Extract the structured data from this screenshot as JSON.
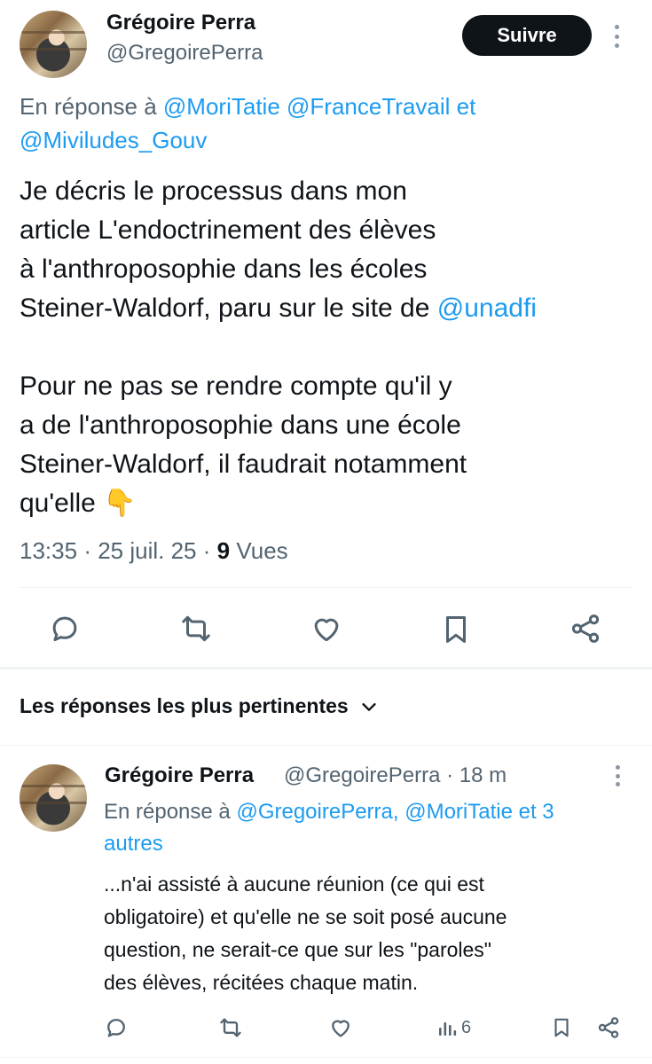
{
  "main_tweet": {
    "author_name": "Grégoire Perra",
    "handle": "@GregoirePerra",
    "follow_label": "Suivre",
    "reply_prefix": "En réponse à",
    "mentions": [
      "@MoriTatie",
      "@FranceTravail",
      "@Miviludes_Gouv"
    ],
    "reply_joiner": "et",
    "body_lines_p1": [
      "Je décris le processus dans mon",
      "article L'endoctrinement des élèves",
      "à l'anthroposophie dans les écoles",
      "Steiner-Waldorf, paru sur le site de"
    ],
    "body_link": "@unadfi",
    "body_lines_p2": [
      "Pour ne pas se rendre compte qu'il y",
      "a de l'anthroposophie dans une école",
      "Steiner-Waldorf, il faudrait notamment",
      "qu'elle"
    ],
    "emoji": "👇",
    "time": "13:35",
    "date": "25 juil. 25",
    "views_count": "9",
    "views_label": "Vues",
    "dot": "·"
  },
  "sort": {
    "label": "Les réponses les plus pertinentes"
  },
  "reply_tweet": {
    "author_name": "Grégoire Perra",
    "handle_time": "@GregoirePerra · 18 m",
    "reply_prefix": "En réponse à",
    "reply_link_1": "@GregoirePerra,",
    "reply_link_2": "@MoriTatie et 3",
    "reply_link_3": "autres",
    "body_lines": [
      "...n'ai assisté à aucune réunion (ce qui est",
      "obligatoire) et qu'elle ne se soit posé aucune",
      "question, ne serait-ce que sur les \"paroles\"",
      "des élèves,  récitées chaque matin."
    ],
    "views_count": "6"
  },
  "icons": {
    "reply": "speech-bubble-icon",
    "retweet": "retweet-icon",
    "like": "heart-icon",
    "bookmark": "bookmark-icon",
    "share": "share-icon",
    "analytics": "bar-chart-icon",
    "more": "more-vertical-icon",
    "chevron": "chevron-down-icon"
  },
  "colors": {
    "text": "#0f1419",
    "secondary": "#536471",
    "link": "#1d9bf0",
    "button_bg": "#0f1419",
    "divider": "#eff3f4"
  }
}
